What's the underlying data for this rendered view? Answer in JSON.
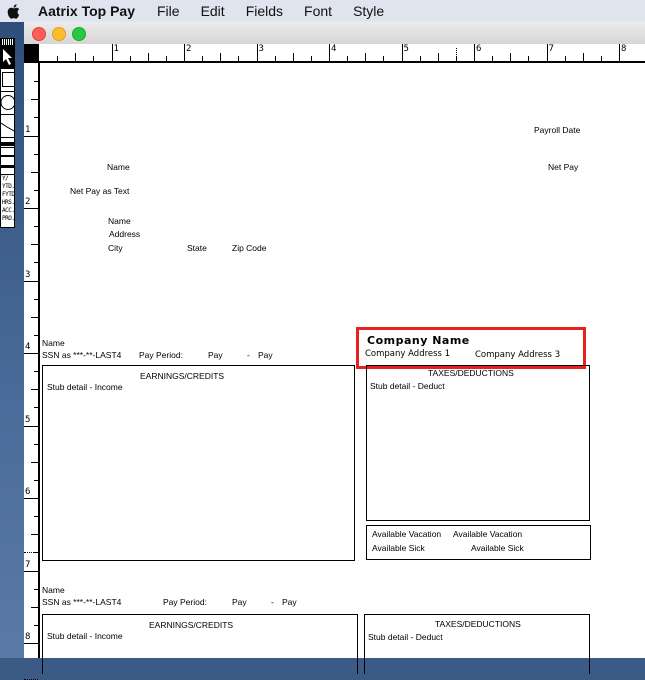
{
  "menubar": {
    "apple_icon": "apple-logo-icon",
    "app_name": "Aatrix Top Pay",
    "items": [
      "File",
      "Edit",
      "Fields",
      "Font",
      "Style"
    ]
  },
  "window": {
    "controls": [
      "close",
      "minimize",
      "zoom"
    ]
  },
  "palette": {
    "tools": [
      "arrow-tool",
      "rectangle-tool",
      "oval-tool",
      "line-tool",
      "thick-line",
      "medium-line",
      "thin-line"
    ],
    "text_items": [
      "Y/",
      "YTD.",
      "FYTD",
      "HRS.",
      "ACC.",
      "PRO."
    ]
  },
  "rulers": {
    "horizontal": [
      "1",
      "2",
      "3",
      "4",
      "5",
      "6",
      "7",
      "8"
    ],
    "vertical": [
      "1",
      "2",
      "3",
      "4",
      "5",
      "6",
      "7",
      "8"
    ]
  },
  "check_section": {
    "payroll_date": "Payroll Date",
    "name": "Name",
    "net_pay": "Net Pay",
    "net_pay_text": "Net Pay as Text",
    "address_name": "Name",
    "address": "Address",
    "city": "City",
    "state": "State",
    "zip": "Zip Code"
  },
  "stub1": {
    "name": "Name",
    "ssn": "SSN as ***-**-LAST4",
    "pay_period_label": "Pay Period:",
    "pay_start": "Pay",
    "dash": "-",
    "pay_end": "Pay",
    "company_name": "Company Name",
    "company_address_1": "Company Address 1",
    "company_address_3": "Company Address 3",
    "earnings_title": "EARNINGS/CREDITS",
    "earnings_detail": "Stub detail - Income",
    "taxes_title": "TAXES/DEDUCTIONS",
    "taxes_detail": "Stub detail - Deduct",
    "vacation_label": "Available Vacation",
    "vacation_value": "Available Vacation",
    "sick_label": "Available Sick",
    "sick_value": "Available Sick"
  },
  "stub2": {
    "name": "Name",
    "ssn": "SSN as ***-**-LAST4",
    "pay_period_label": "Pay Period:",
    "pay_start": "Pay",
    "dash": "-",
    "pay_end": "Pay",
    "earnings_title": "EARNINGS/CREDITS",
    "earnings_detail": "Stub detail - Income",
    "taxes_title": "TAXES/DEDUCTIONS",
    "taxes_detail": "Stub detail - Deduct"
  },
  "colors": {
    "highlight": "#e8211f"
  }
}
